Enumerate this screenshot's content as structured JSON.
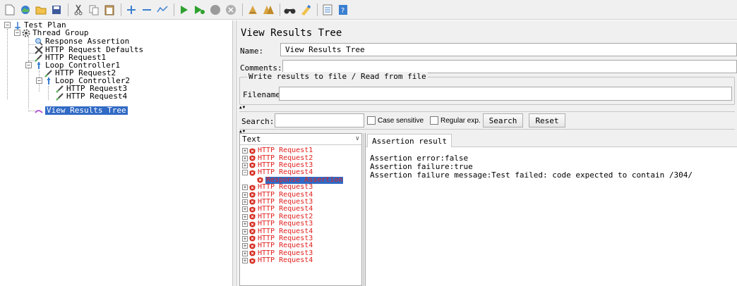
{
  "toolbar": {
    "buttons": [
      "new-icon",
      "templates-icon",
      "open-icon",
      "save-icon",
      "cut-icon",
      "copy-icon",
      "paste-icon",
      "expand-icon",
      "collapse-icon",
      "toggle-icon",
      "start-icon",
      "start-no-pause-icon",
      "stop-icon",
      "shutdown-icon",
      "clear-icon",
      "clear-all-icon",
      "search-icon",
      "reset-search-icon",
      "function-helper-icon",
      "help-icon"
    ]
  },
  "test_tree": {
    "test_plan": "Test Plan",
    "thread_group": "Thread Group",
    "response_assertion": "Response Assertion",
    "http_defaults": "HTTP Request Defaults",
    "http_request1": "HTTP Request1",
    "loop_controller1": "Loop Controller1",
    "http_request2": "HTTP Request2",
    "loop_controller2": "Loop Controller2",
    "http_request3": "HTTP Request3",
    "http_request4": "HTTP Request4",
    "view_results_tree": "View Results Tree"
  },
  "panel": {
    "title": "View Results Tree",
    "name_label": "Name:",
    "name_value": "View Results Tree",
    "comments_label": "Comments:",
    "comments_value": "",
    "file_group_label": "Write results to file / Read from file",
    "filename_label": "Filename",
    "filename_value": ""
  },
  "search": {
    "label": "Search:",
    "value": "",
    "case_sensitive": "Case sensitive",
    "regular_exp": "Regular exp.",
    "search_button": "Search",
    "reset_button": "Reset"
  },
  "results": {
    "renderer": "Text",
    "rows": [
      {
        "label": "HTTP Request1",
        "expanded": false
      },
      {
        "label": "HTTP Request2",
        "expanded": false
      },
      {
        "label": "HTTP Request3",
        "expanded": false
      },
      {
        "label": "HTTP Request4",
        "expanded": true
      },
      {
        "label": "Response Assertion",
        "child": true,
        "selected": true
      },
      {
        "label": "HTTP Request3",
        "expanded": false
      },
      {
        "label": "HTTP Request4",
        "expanded": false
      },
      {
        "label": "HTTP Request3",
        "expanded": false
      },
      {
        "label": "HTTP Request4",
        "expanded": false
      },
      {
        "label": "HTTP Request2",
        "expanded": false
      },
      {
        "label": "HTTP Request3",
        "expanded": false
      },
      {
        "label": "HTTP Request4",
        "expanded": false
      },
      {
        "label": "HTTP Request3",
        "expanded": false
      },
      {
        "label": "HTTP Request4",
        "expanded": false
      },
      {
        "label": "HTTP Request3",
        "expanded": false
      },
      {
        "label": "HTTP Request4",
        "expanded": false
      }
    ]
  },
  "assertion_tab": {
    "tab_label": "Assertion result",
    "lines": [
      "Assertion error:false",
      "Assertion failure:true",
      "Assertion failure message:Test failed: code expected to contain /304/"
    ]
  },
  "colors": {
    "selection": "#316ac5",
    "error_text": "#e0201e",
    "panel_bg": "#f0f0f0"
  }
}
